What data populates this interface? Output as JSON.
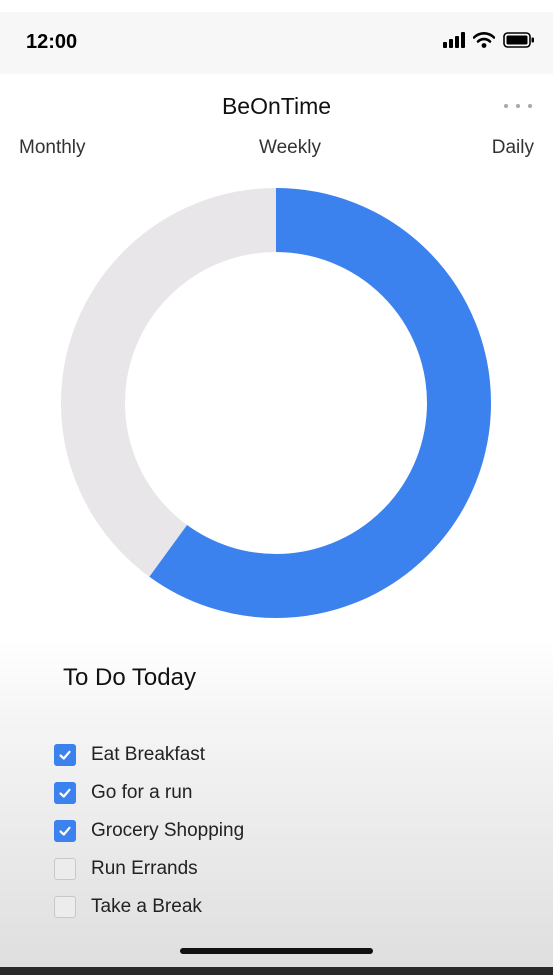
{
  "status_bar": {
    "time": "12:00"
  },
  "header": {
    "title": "BeOnTime"
  },
  "tabs": [
    {
      "label": "Monthly"
    },
    {
      "label": "Weekly"
    },
    {
      "label": "Daily"
    }
  ],
  "chart_data": {
    "type": "pie",
    "style": "donut",
    "completed_fraction": 0.6,
    "colors": {
      "completed": "#3b82ee",
      "remaining": "#e8e6e8"
    }
  },
  "todo": {
    "title": "To Do Today",
    "items": [
      {
        "label": "Eat Breakfast",
        "checked": true
      },
      {
        "label": "Go for a run",
        "checked": true
      },
      {
        "label": "Grocery Shopping",
        "checked": true
      },
      {
        "label": "Run Errands",
        "checked": false
      },
      {
        "label": "Take a Break",
        "checked": false
      }
    ]
  }
}
